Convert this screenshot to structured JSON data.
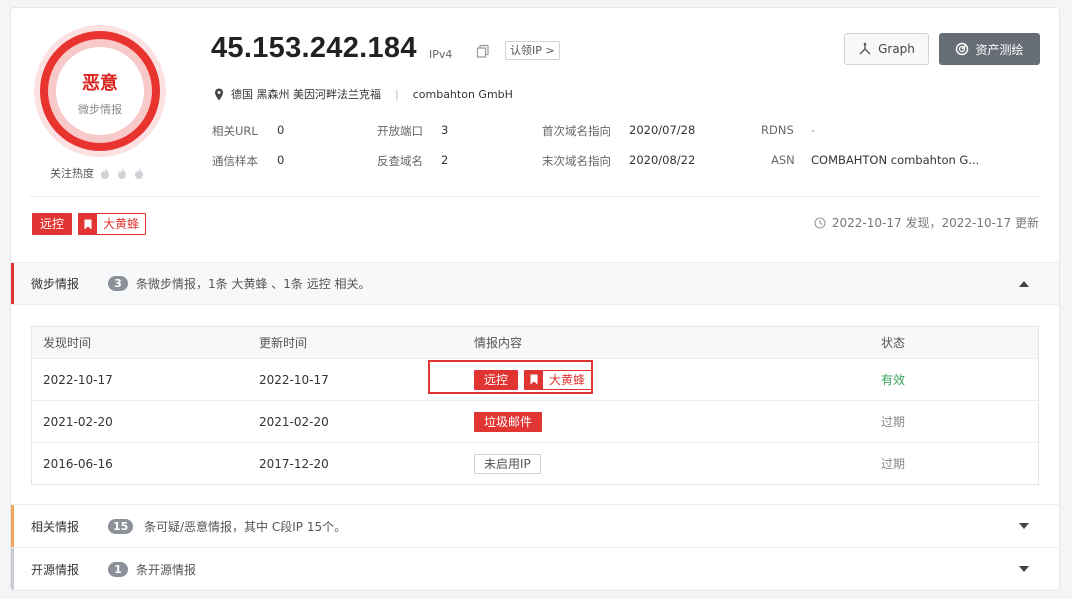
{
  "verdict": {
    "label": "恶意",
    "source": "微步情报"
  },
  "heat_label": "关注热度",
  "ip": {
    "address": "45.153.242.184",
    "version": "IPv4",
    "claim_label": "认领IP >"
  },
  "location": {
    "region": "德国 黑森州 美因河畔法兰克福",
    "org": "combahton GmbH"
  },
  "meta": {
    "related_url_label": "相关URL",
    "related_url_value": "0",
    "open_ports_label": "开放端口",
    "open_ports_value": "3",
    "first_resolve_label": "首次域名指向",
    "first_resolve_value": "2020/07/28",
    "rdns_label": "RDNS",
    "rdns_value": "-",
    "samples_label": "通信样本",
    "samples_value": "0",
    "reverse_label": "反查域名",
    "reverse_value": "2",
    "last_resolve_label": "末次域名指向",
    "last_resolve_value": "2020/08/22",
    "asn_label": "ASN",
    "asn_value": "COMBAHTON combahton G..."
  },
  "buttons": {
    "graph": "Graph",
    "asset_map": "资产测绘"
  },
  "tags": {
    "remote_control": "远控",
    "gang": "大黄蜂"
  },
  "found_text": "2022-10-17 发现，2022-10-17 更新",
  "sections": {
    "threat": {
      "title": "微步情报",
      "count": "3",
      "desc": "条微步情报，1条 大黄蜂 、1条 远控 相关。"
    },
    "related": {
      "title": "相关情报",
      "count": "15",
      "desc": "条可疑/恶意情报，其中 C段IP 15个。"
    },
    "opensource": {
      "title": "开源情报",
      "count": "1",
      "desc": "条开源情报"
    }
  },
  "table": {
    "headers": [
      "发现时间",
      "更新时间",
      "情报内容",
      "状态"
    ],
    "rows": [
      {
        "found": "2022-10-17",
        "updated": "2022-10-17",
        "tag1": "远控",
        "tag2": "大黄蜂",
        "status": "有效"
      },
      {
        "found": "2021-02-20",
        "updated": "2021-02-20",
        "tag1": "垃圾邮件",
        "status": "过期"
      },
      {
        "found": "2016-06-16",
        "updated": "2017-12-20",
        "tag1": "未启用IP",
        "status": "过期"
      }
    ]
  },
  "colors": {
    "malicious": "#e03532",
    "valid": "#3aa55a",
    "related_accent": "#f0a35a",
    "section_gray": "#c7cbd1"
  },
  "icons": [
    "flame-icon",
    "copy-icon",
    "pin-icon",
    "graph-icon",
    "radar-icon",
    "bookmark-icon",
    "clock-icon",
    "chevron-up-icon",
    "chevron-down-icon"
  ]
}
